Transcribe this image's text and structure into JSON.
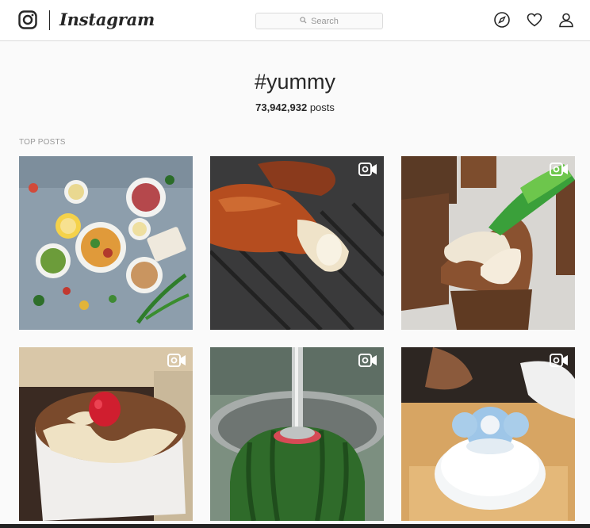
{
  "header": {
    "app_name": "Instagram",
    "search_placeholder": "Search",
    "icons": [
      "compass-icon",
      "heart-icon",
      "profile-icon"
    ]
  },
  "hashtag": {
    "title": "#yummy",
    "post_count": "73,942,932",
    "post_count_unit": "posts"
  },
  "section": {
    "label": "TOP POSTS"
  },
  "posts": [
    {
      "subject": "food flat lay",
      "is_video": false
    },
    {
      "subject": "grilled squid",
      "is_video": true
    },
    {
      "subject": "chocolate cake decorating",
      "is_video": true
    },
    {
      "subject": "tiramisu cake with strawberry",
      "is_video": true
    },
    {
      "subject": "watermelon blender",
      "is_video": true
    },
    {
      "subject": "shaved ice dessert",
      "is_video": true,
      "overlay_text": "present"
    }
  ]
}
